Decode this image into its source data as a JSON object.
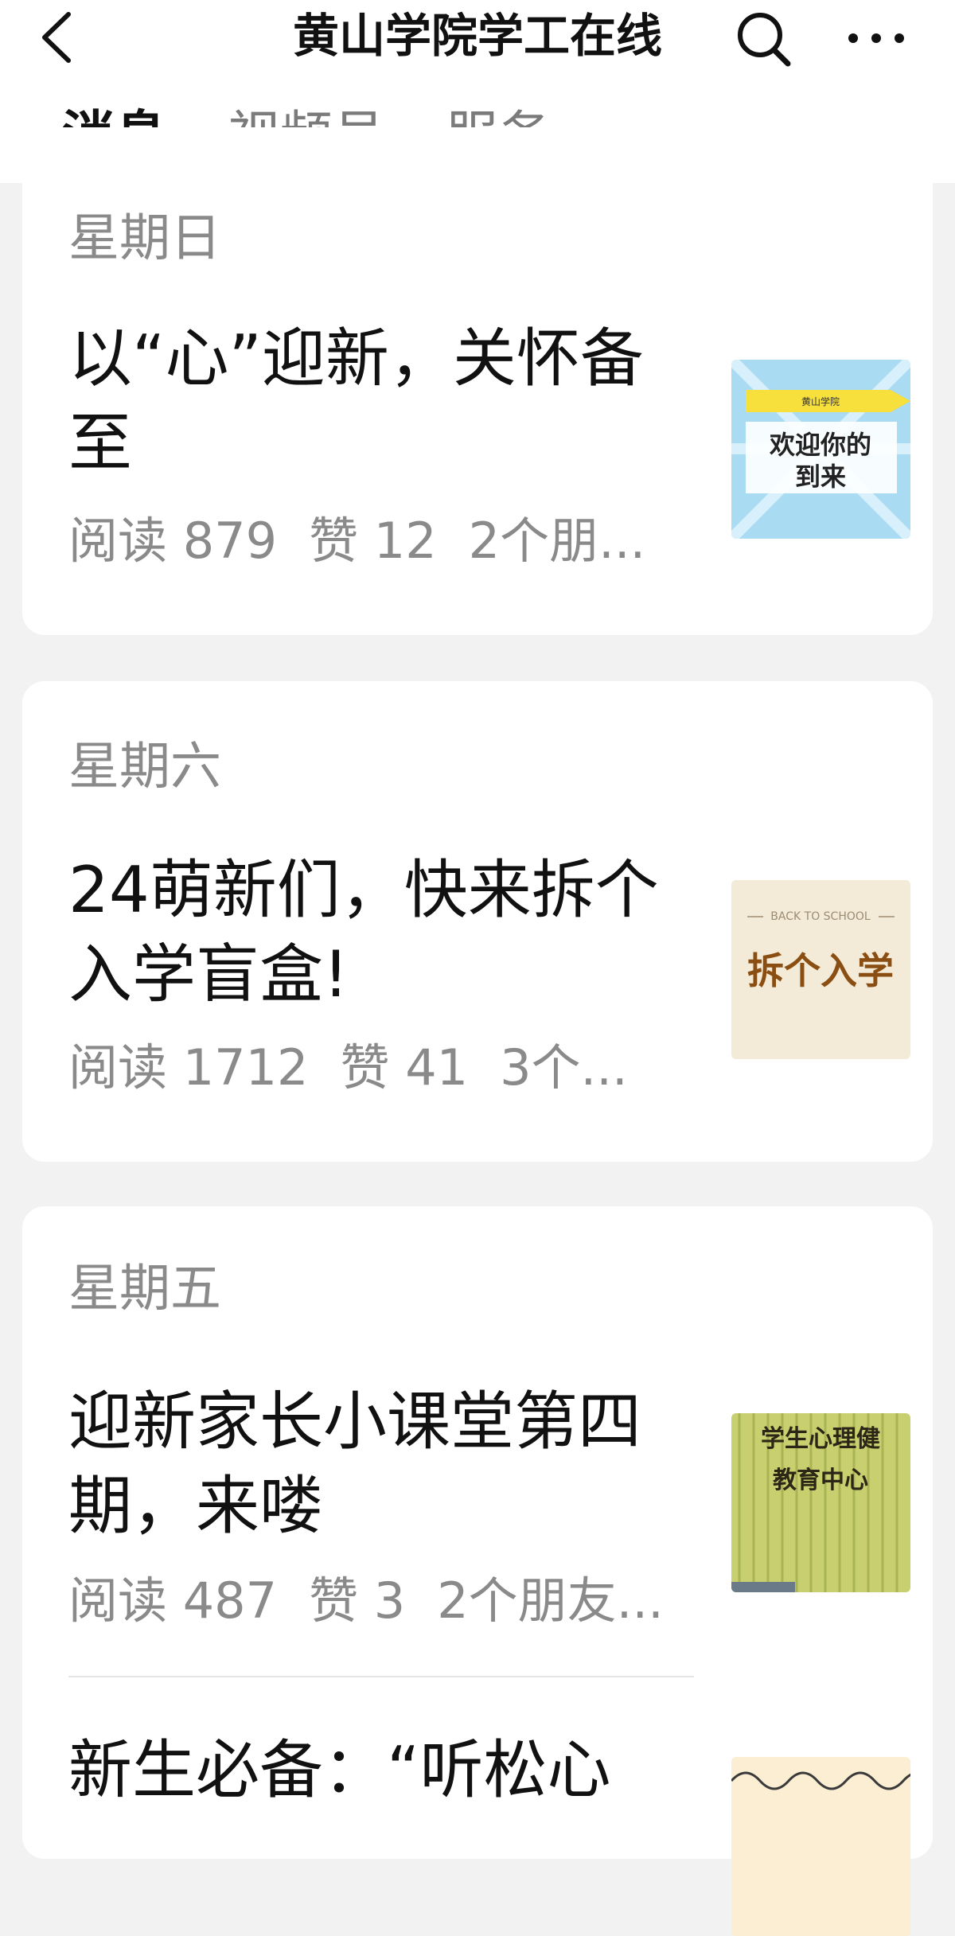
{
  "header": {
    "title": "黄山学院学工在线",
    "back_icon": "chevron-left-icon",
    "search_icon": "search-icon",
    "more_icon": "more-horizontal-icon"
  },
  "tabs": [
    {
      "label": "消息",
      "active": true
    },
    {
      "label": "视频号",
      "active": false
    },
    {
      "label": "服务",
      "active": false
    }
  ],
  "days": [
    {
      "date": "星期日",
      "articles": [
        {
          "title": "以“心”迎新，关怀备至",
          "read": "阅读 879",
          "likes": "赞 12",
          "friends": "2个朋...",
          "thumb_text": [
            "黄山学院",
            "欢迎你的",
            "到来"
          ]
        }
      ]
    },
    {
      "date": "星期六",
      "articles": [
        {
          "title": "24萌新们，快来拆个入学盲盒!",
          "read": "阅读 1712",
          "likes": "赞 41",
          "friends": "3个...",
          "thumb_text": [
            "BACK TO SCHOOL",
            "拆个入学"
          ]
        }
      ]
    },
    {
      "date": "星期五",
      "articles": [
        {
          "title": "迎新家长小课堂第四期，来喽",
          "read": "阅读 487",
          "likes": "赞 3",
          "friends": "2个朋友...",
          "thumb_text": [
            "学生心理健",
            "教育中心"
          ]
        },
        {
          "title": "新生必备：“听松心",
          "read": "",
          "likes": "",
          "friends": "",
          "thumb_text": []
        }
      ]
    }
  ],
  "colors": {
    "background": "#f2f2f2",
    "card": "#ffffff",
    "muted_text": "#8a8a8a",
    "primary_text": "#111111"
  }
}
